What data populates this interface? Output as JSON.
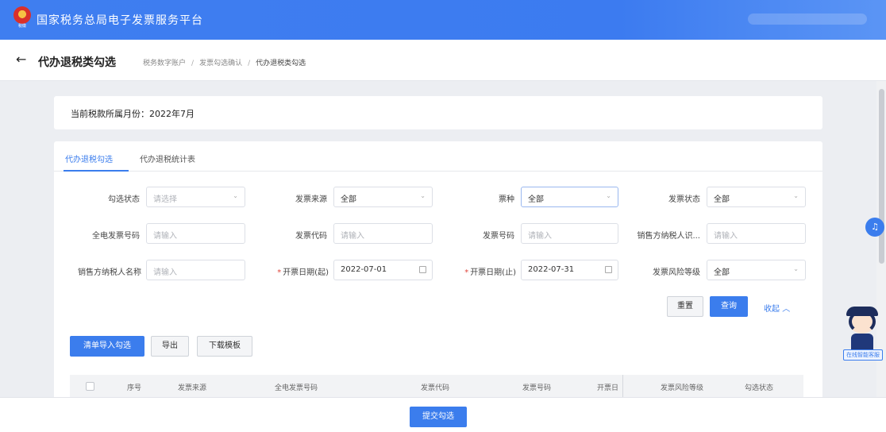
{
  "header": {
    "title": "国家税务总局电子发票服务平台",
    "emblem_caption": "税徽"
  },
  "page": {
    "back_icon": "←",
    "title": "代办退税类勾选",
    "breadcrumbs": [
      "税务数字账户",
      "发票勾选确认",
      "代办退税类勾选"
    ]
  },
  "period": {
    "text": "当前税款所属月份：2022年7月"
  },
  "tabs": [
    {
      "label": "代办退税勾选",
      "active": true
    },
    {
      "label": "代办退税统计表",
      "active": false
    }
  ],
  "filters": [
    {
      "label": "勾选状态",
      "value": "请选择",
      "kind": "select",
      "placeholder": true
    },
    {
      "label": "发票来源",
      "value": "全部",
      "kind": "select"
    },
    {
      "label": "票种",
      "value": "全部",
      "kind": "select",
      "focused": true
    },
    {
      "label": "发票状态",
      "value": "全部",
      "kind": "select"
    },
    {
      "label": "全电发票号码",
      "value": "请输入",
      "kind": "input",
      "placeholder": true
    },
    {
      "label": "发票代码",
      "value": "请输入",
      "kind": "input",
      "placeholder": true
    },
    {
      "label": "发票号码",
      "value": "请输入",
      "kind": "input",
      "placeholder": true
    },
    {
      "label": "销售方纳税人识...",
      "value": "请输入",
      "kind": "input",
      "placeholder": true
    },
    {
      "label": "销售方纳税人名称",
      "value": "请输入",
      "kind": "input",
      "placeholder": true
    },
    {
      "label": "开票日期(起)",
      "value": "2022-07-01",
      "kind": "date",
      "required": true
    },
    {
      "label": "开票日期(止)",
      "value": "2022-07-31",
      "kind": "date",
      "required": true
    },
    {
      "label": "发票风险等级",
      "value": "全部",
      "kind": "select"
    }
  ],
  "actions": {
    "reset": "重置",
    "query": "查询",
    "collapse": "收起",
    "collapse_icon": "chevron-up"
  },
  "toolbar": {
    "import": "清单导入勾选",
    "export": "导出",
    "download": "下载模板"
  },
  "table": {
    "columns": [
      "序号",
      "发票来源",
      "全电发票号码",
      "发票代码",
      "发票号码",
      "开票日",
      "发票风险等级",
      "勾选状态"
    ]
  },
  "footer": {
    "submit": "提交勾选"
  },
  "assistant": {
    "label": "在线智能客服",
    "headset_icon": "headset"
  },
  "colors": {
    "primary": "#3b7ded",
    "header_bg": "#3f7ef0",
    "page_bg": "#eceef2"
  }
}
